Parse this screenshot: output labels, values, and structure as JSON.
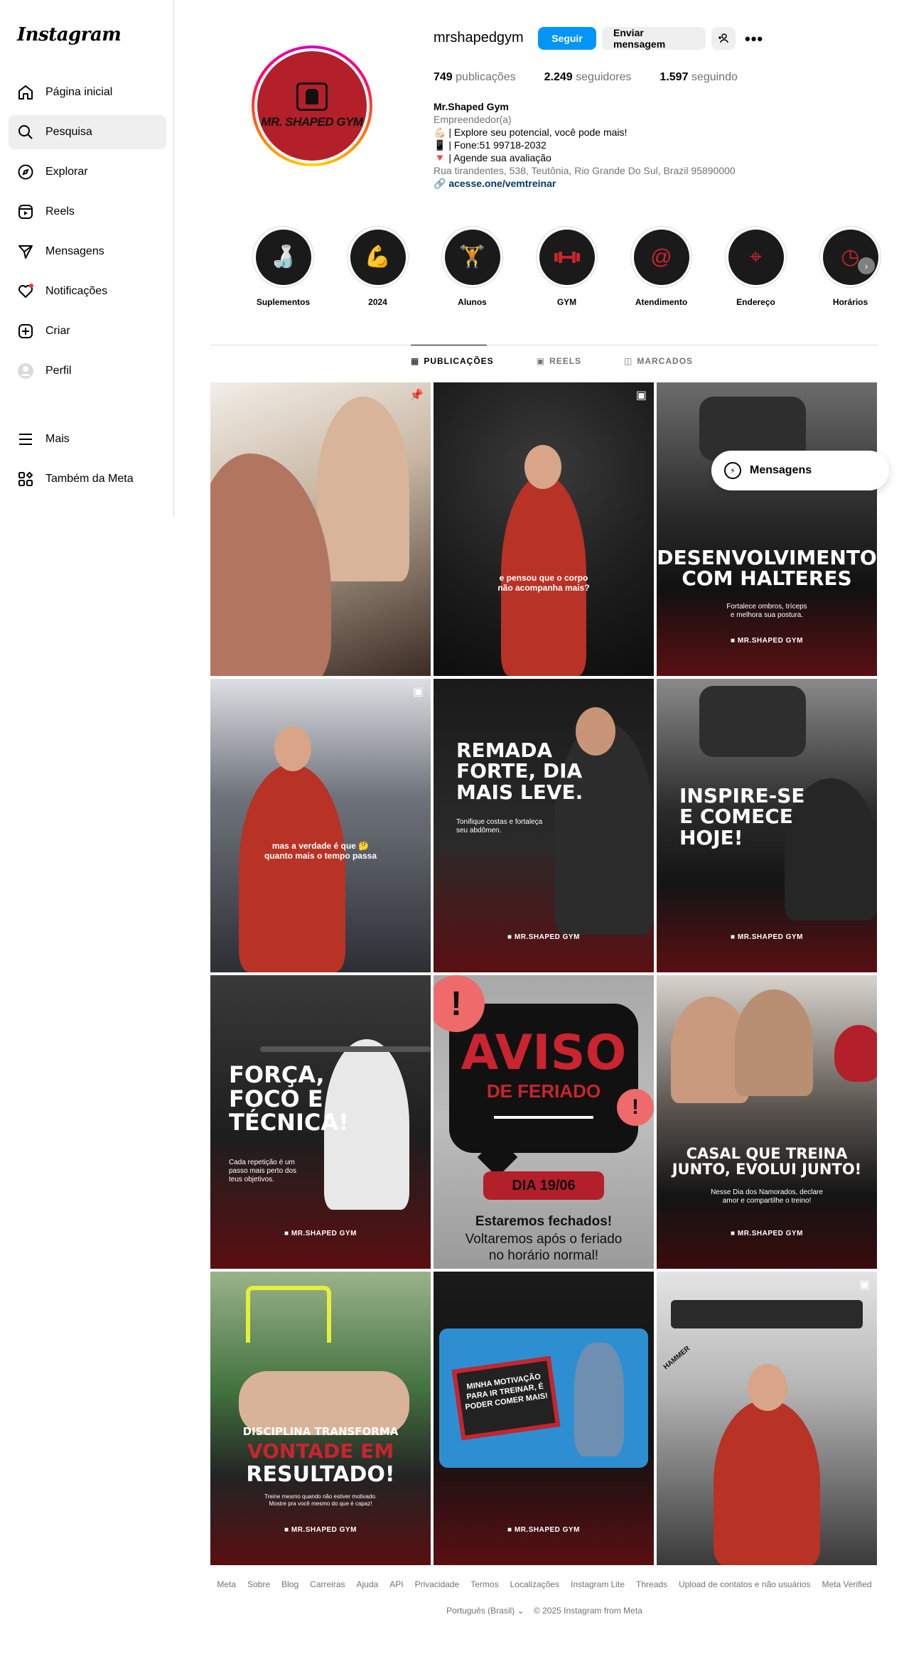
{
  "sidebar": {
    "logo": "Instagram",
    "items": [
      {
        "label": "Página inicial"
      },
      {
        "label": "Pesquisa"
      },
      {
        "label": "Explorar"
      },
      {
        "label": "Reels"
      },
      {
        "label": "Mensagens"
      },
      {
        "label": "Notificações"
      },
      {
        "label": "Criar"
      },
      {
        "label": "Perfil"
      }
    ],
    "more": [
      {
        "label": "Mais"
      },
      {
        "label": "Também da Meta"
      }
    ]
  },
  "profile": {
    "pic_text": "MR. SHAPED GYM",
    "username": "mrshapedgym",
    "follow_label": "Seguir",
    "message_label": "Enviar mensagem",
    "stats": {
      "posts_count": "749",
      "posts_label": " publicações",
      "followers_count": "2.249",
      "followers_label": " seguidores",
      "following_count": "1.597",
      "following_label": " seguindo"
    },
    "bio": {
      "name": "Mr.Shaped Gym",
      "category": "Empreendedor(a)",
      "line1": "💪🏻 | Explore seu potencial, você pode mais!",
      "line2": "📱 | Fone:51 99718-2032",
      "line3": "🔻 | Agende sua avaliação",
      "address": "Rua tirandentes, 538, Teutônia, Rio Grande Do Sul, Brazil 95890000",
      "link": "acesse.one/vemtreinar"
    }
  },
  "highlights": [
    {
      "label": "Suplementos",
      "icon": "supplement-icon",
      "glyph": "🍶"
    },
    {
      "label": "2024",
      "icon": "dumbbell-icon",
      "glyph": "💪"
    },
    {
      "label": "Alunos",
      "icon": "athlete-icon",
      "glyph": "🏋"
    },
    {
      "label": "GYM",
      "icon": "barbell-icon",
      "glyph": "⎯"
    },
    {
      "label": "Atendimento",
      "icon": "at-icon",
      "glyph": "@"
    },
    {
      "label": "Endereço",
      "icon": "location-icon",
      "glyph": "⌖"
    },
    {
      "label": "Horários",
      "icon": "clock-icon",
      "glyph": "◷"
    }
  ],
  "tabs": [
    {
      "label": "PUBLICAÇÕES"
    },
    {
      "label": "REELS"
    },
    {
      "label": "MARCADOS"
    }
  ],
  "posts": {
    "p2_caption": "e pensou que o corpo\nnão acompanha mais?",
    "p3_title": "DESENVOLVIMENTO\nCOM HALTERES",
    "p3_sub": "Fortalece ombros, tríceps\ne melhora sua postura.",
    "p4_caption": "mas a verdade é que 🤔\nquanto mais o tempo passa",
    "p5_title": "REMADA\nFORTE, DIA\nMAIS LEVE.",
    "p5_sub": "Tonifique costas e fortaleça\nseu abdômen.",
    "p6_title": "INSPIRE-SE\nE COMECE\nHOJE!",
    "p7_title": "FORÇA,\nFOCO E\nTÉCNICA!",
    "p7_sub": "Cada repetição é um\npasso mais perto dos\nteus objetivos.",
    "p8_title": "AVISO",
    "p8_sub": "DE FERIADO",
    "p8_date": "DIA 19/06",
    "p8_closed": "Estaremos fechados!",
    "p8_back": "Voltaremos após o feriado\nno horário normal!",
    "p9_title": "CASAL QUE TREINA\nJUNTO, EVOLUI JUNTO!",
    "p9_sub": "Nesse Dia dos Namorados, declare\namor e compartilhe o treino!",
    "p10_pre": "DISCIPLINA TRANSFORMA",
    "p10_red": "VONTADE EM",
    "p10_white": "RESULTADO!",
    "p10_sub": "Treine mesmo quando não estiver motivado.\nMostre pra você mesmo do que é capaz!",
    "p11_board": "MINHA MOTIVAÇÃO\nPARA IR TREINAR, É\nPODER COMER MAIS!",
    "p12_label": "HAMMER",
    "brand": "MR.SHAPED GYM"
  },
  "messages_float": {
    "label": "Mensagens"
  },
  "footer": {
    "links": [
      "Meta",
      "Sobre",
      "Blog",
      "Carreiras",
      "Ajuda",
      "API",
      "Privacidade",
      "Termos",
      "Localizações",
      "Instagram Lite",
      "Threads",
      "Upload de contatos e não usuários",
      "Meta Verified"
    ],
    "language": "Português (Brasil)",
    "copyright": "© 2025 Instagram from Meta"
  },
  "colors": {
    "accent": "#0095f6",
    "brand_red": "#b3202a",
    "notification_dot": "#ff3040"
  }
}
